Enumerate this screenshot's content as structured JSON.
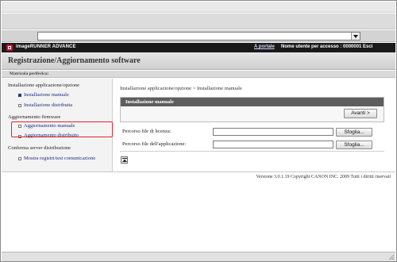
{
  "brand": {
    "name": "imageRUNNER ADVANCE",
    "portal_link": "A portale",
    "user_info": "Nome utente per accesso : 0000001 Esci"
  },
  "page": {
    "title": "Registrazione/Aggiornamento software",
    "serial_label": "Matricola periferica:"
  },
  "sidebar": {
    "sections": [
      {
        "heading": "Installazione applicazione/opzione",
        "items": [
          {
            "label": "Installazione manuale",
            "active": true
          },
          {
            "label": "Installazione distribuita",
            "active": false
          }
        ]
      },
      {
        "heading": "Aggiornamento firmware",
        "items": [
          {
            "label": "Aggiornamento manuale",
            "active": false
          },
          {
            "label": "Aggiornamento distribuito",
            "active": false
          }
        ]
      },
      {
        "heading": "Conferma server distribuzione",
        "items": [
          {
            "label": "Mostra registri/test comunicazione",
            "active": false
          }
        ]
      }
    ]
  },
  "main": {
    "breadcrumb": "Installazione applicazione/opzione > Installazione manuale",
    "panel_title": "Installazione manuale",
    "next_label": "Avanti >",
    "license_label": "Percorso file di licenza:",
    "app_label": "Percorso file dell'applicazione:",
    "license_value": "",
    "app_value": "",
    "browse_label": "Sfoglia..."
  },
  "footer": {
    "copyright": "Versione 3.0.1.19 Copyright CANON INC. 2009 Tutti i diritti riservati"
  },
  "colors": {
    "brand_bar": "#1a1a1a",
    "panel_header": "#5e5e5e",
    "highlight": "#e0252f",
    "link": "#1c2c7a"
  }
}
